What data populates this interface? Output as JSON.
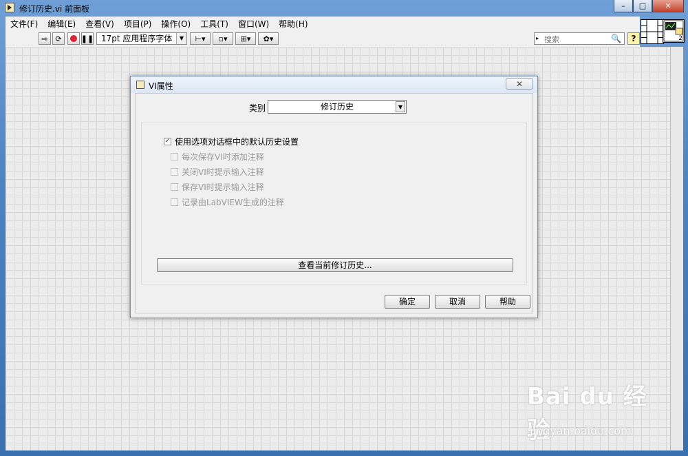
{
  "window": {
    "title": "修订历史.vi 前面板",
    "controls": {
      "minimize": "–",
      "maximize": "□",
      "close": "✕"
    }
  },
  "menubar": {
    "items": [
      "文件(F)",
      "编辑(E)",
      "查看(V)",
      "项目(P)",
      "操作(O)",
      "工具(T)",
      "窗口(W)",
      "帮助(H)"
    ]
  },
  "toolbar": {
    "font_select": "17pt 应用程序字体",
    "search_placeholder": "搜索",
    "help_label": "?"
  },
  "icons": {
    "run": "run-arrow-icon",
    "run_continuous": "run-continuously-icon",
    "abort": "abort-icon",
    "pause": "pause-icon",
    "align": "align-objects-icon",
    "distribute": "distribute-objects-icon",
    "resize": "resize-objects-icon",
    "reorder": "reorder-icon",
    "search": "magnifier-icon"
  },
  "vi_icon": {
    "number": "2"
  },
  "dialog": {
    "title": "VI属性",
    "close_label": "✕",
    "category_label": "类别",
    "category_value": "修订历史",
    "use_default_label": "使用选项对话框中的默认历史设置",
    "use_default_checked": true,
    "options": [
      {
        "label": "每次保存VI时添加注释",
        "checked": false,
        "enabled": false
      },
      {
        "label": "关闭VI时提示输入注释",
        "checked": false,
        "enabled": false
      },
      {
        "label": "保存VI时提示输入注释",
        "checked": false,
        "enabled": false
      },
      {
        "label": "记录由LabVIEW生成的注释",
        "checked": false,
        "enabled": false
      }
    ],
    "view_history_button": "查看当前修订历史...",
    "ok_button": "确定",
    "cancel_button": "取消",
    "help_button": "帮助"
  },
  "watermark": {
    "logo": "Bai du 经验",
    "url": "jingyan.baidu.com"
  },
  "colors": {
    "grid": "#d6d6d6",
    "canvas": "#ececec",
    "window_frame": "#4d83c2"
  }
}
